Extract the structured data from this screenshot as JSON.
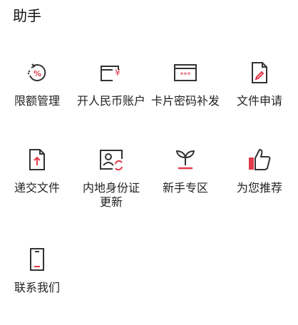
{
  "section_title": "助手",
  "colors": {
    "accent": "#e03a4a",
    "icon": "#333333"
  },
  "items": [
    {
      "label": "限额管理",
      "icon": "limit-gauge-icon"
    },
    {
      "label": "开人民币账户",
      "icon": "rmb-card-icon"
    },
    {
      "label": "卡片密码补发",
      "icon": "card-password-icon"
    },
    {
      "label": "文件申请",
      "icon": "document-edit-icon"
    },
    {
      "label": "递交文件",
      "icon": "document-upload-icon"
    },
    {
      "label": "内地身份证\n更新",
      "icon": "id-card-refresh-icon"
    },
    {
      "label": "新手专区",
      "icon": "sprout-icon"
    },
    {
      "label": "为您推荐",
      "icon": "thumbs-up-icon"
    },
    {
      "label": "联系我们",
      "icon": "phone-icon"
    }
  ]
}
